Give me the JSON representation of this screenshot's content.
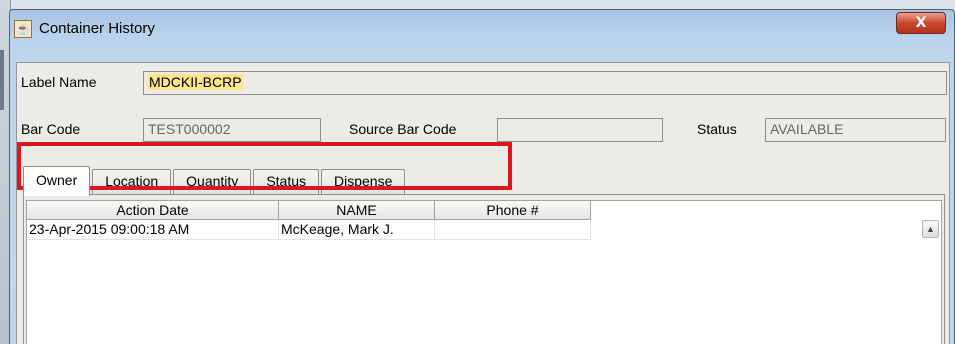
{
  "window": {
    "title": "Container History",
    "close_label": "X"
  },
  "form": {
    "label_name_label": "Label Name",
    "label_name_value": "MDCKII-BCRP",
    "bar_code_label": "Bar Code",
    "bar_code_value": "TEST000002",
    "source_bar_code_label": "Source Bar Code",
    "source_bar_code_value": "",
    "status_label": "Status",
    "status_value": "AVAILABLE"
  },
  "tabs": [
    {
      "label": "Owner",
      "active": true
    },
    {
      "label": "Location",
      "active": false
    },
    {
      "label": "Quantity",
      "active": false
    },
    {
      "label": "Status",
      "active": false
    },
    {
      "label": "Dispense",
      "active": false
    }
  ],
  "table": {
    "columns": [
      "Action Date",
      "NAME",
      "Phone #"
    ],
    "rows": [
      [
        "23-Apr-2015 09:00:18 AM",
        "McKeage, Mark J.",
        ""
      ]
    ]
  },
  "icons": {
    "title": "java-cup-icon",
    "scroll_up": "scroll-up-arrow-icon"
  },
  "colors": {
    "highlight_annotation": "#e0161e",
    "field_highlight": "#ffe58a",
    "close_button": "#c8492d"
  }
}
